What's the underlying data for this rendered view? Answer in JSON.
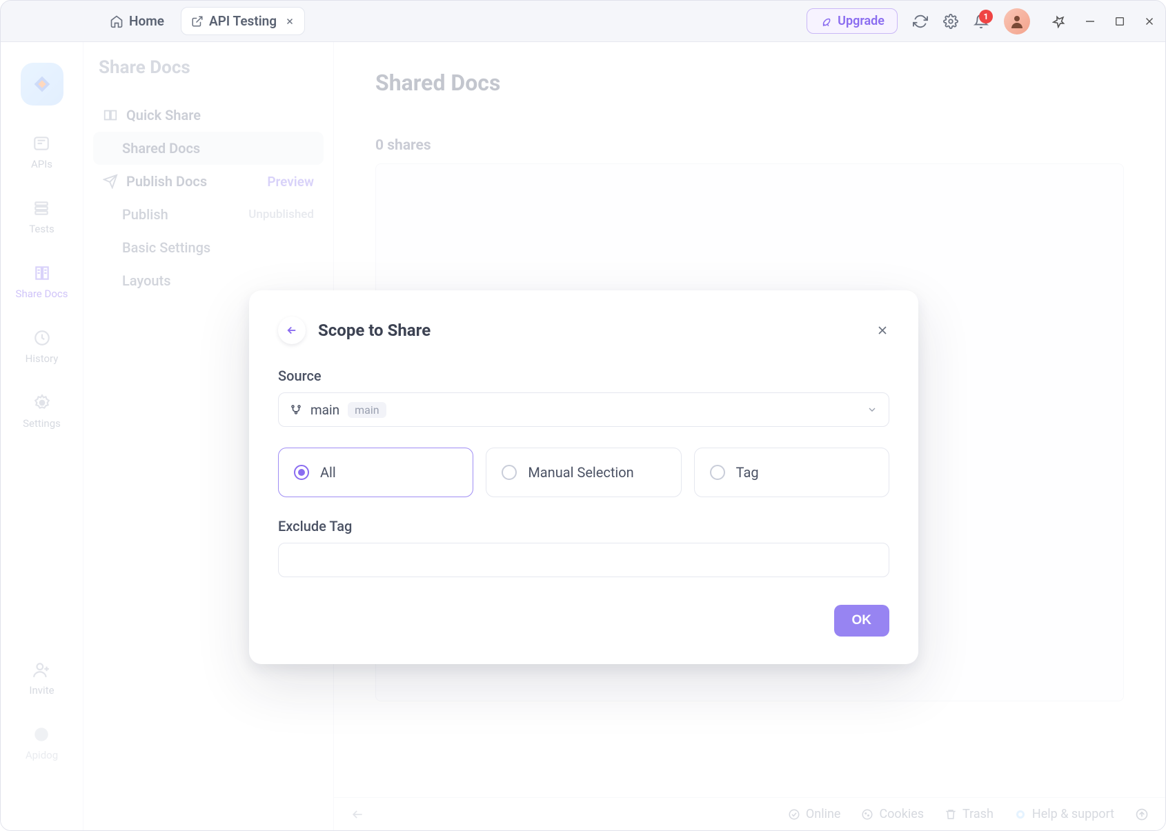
{
  "titlebar": {
    "tabs": [
      {
        "label": "Home",
        "active": false
      },
      {
        "label": "API Testing",
        "active": true
      }
    ],
    "upgrade_label": "Upgrade",
    "notification_count": "1"
  },
  "rail": {
    "items": [
      {
        "label": "APIs"
      },
      {
        "label": "Tests"
      },
      {
        "label": "Share Docs",
        "active": true
      },
      {
        "label": "History"
      },
      {
        "label": "Settings"
      }
    ],
    "invite_label": "Invite",
    "bottom_label": "Apidog"
  },
  "sidebar": {
    "title": "Share Docs",
    "quick_share": "Quick Share",
    "shared_docs": "Shared Docs",
    "publish_docs": "Publish Docs",
    "preview": "Preview",
    "publish": "Publish",
    "publish_status": "Unpublished",
    "basic_settings": "Basic Settings",
    "layouts": "Layouts"
  },
  "content": {
    "heading": "Shared Docs",
    "shares_count": "0 shares"
  },
  "footer": {
    "online": "Online",
    "cookies": "Cookies",
    "trash": "Trash",
    "help": "Help & support"
  },
  "modal": {
    "title": "Scope to Share",
    "source_label": "Source",
    "source_value": "main",
    "source_chip": "main",
    "options": {
      "all": "All",
      "manual": "Manual Selection",
      "tag": "Tag"
    },
    "exclude_label": "Exclude Tag",
    "ok_label": "OK"
  }
}
